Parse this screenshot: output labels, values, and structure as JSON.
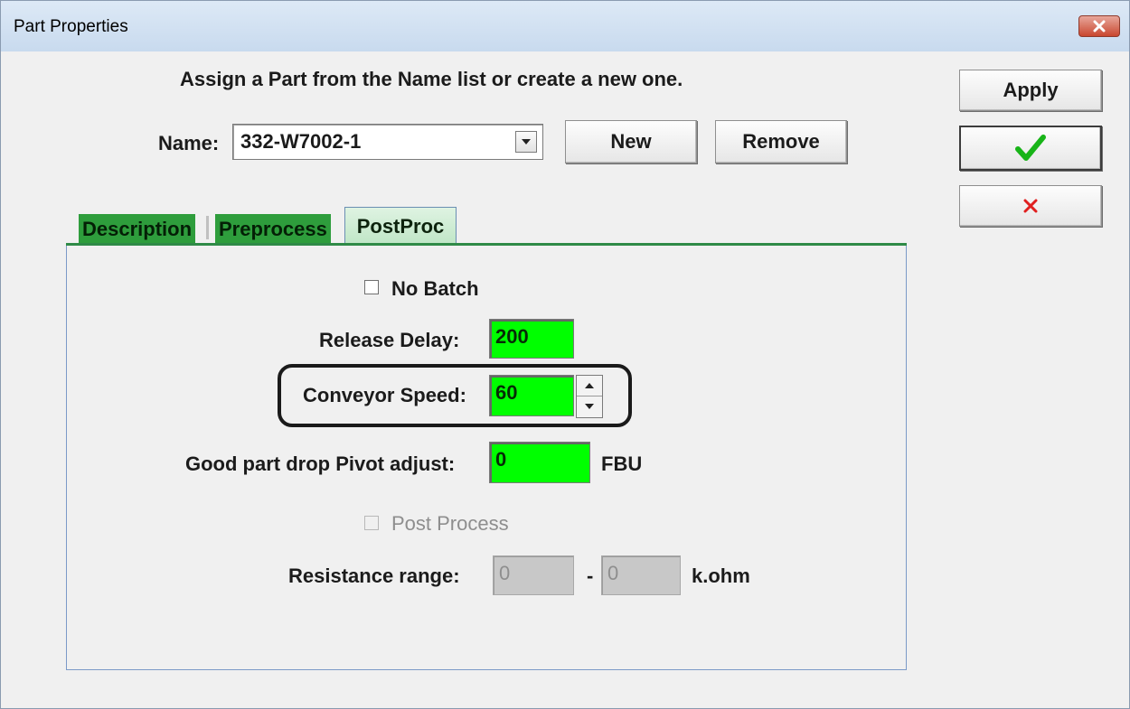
{
  "window": {
    "title": "Part Properties"
  },
  "header": {
    "instruction": "Assign a Part from the Name list or create a new one.",
    "name_label": "Name:",
    "name_value": "332-W7002-1",
    "new_label": "New",
    "remove_label": "Remove"
  },
  "side_buttons": {
    "apply_label": "Apply",
    "ok_icon": "check-icon",
    "cancel_icon": "x-icon"
  },
  "tabs": [
    {
      "label": "Description",
      "active": false
    },
    {
      "label": "Preprocess",
      "active": false
    },
    {
      "label": "PostProc",
      "active": true
    }
  ],
  "postproc": {
    "no_batch_label": "No Batch",
    "no_batch_checked": false,
    "release_delay_label": "Release Delay:",
    "release_delay_value": "200",
    "conveyor_speed_label": "Conveyor Speed:",
    "conveyor_speed_value": "60",
    "pivot_label": "Good part drop Pivot adjust:",
    "pivot_value": "0",
    "pivot_unit": "FBU",
    "post_process_label": "Post Process",
    "post_process_checked": false,
    "resistance_label": "Resistance range:",
    "resistance_min": "0",
    "resistance_separator": "-",
    "resistance_max": "0",
    "resistance_unit": "k.ohm"
  },
  "colors": {
    "field_green": "#00ff00",
    "tab_green": "#2e9d3c",
    "check_green": "#18b418",
    "cancel_red": "#e02020"
  }
}
